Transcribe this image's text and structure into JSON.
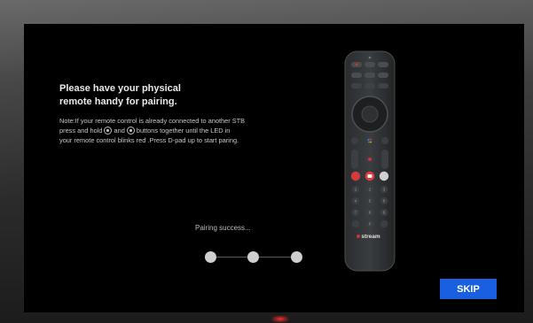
{
  "title": {
    "line1": "Please have your physical",
    "line2": "remote handy for pairing."
  },
  "note": {
    "line1": "Note:If your remote control is already connected to another STB",
    "line2_pre": "press and hold",
    "line2_mid": "and",
    "line2_post": "buttons together until the LED in",
    "line3": "your remote control blinks red .Press D-pad up to start paring."
  },
  "status": "Pairing success...",
  "progress": {
    "total_steps": 3,
    "current_step": 3
  },
  "skip_label": "SKIP",
  "remote": {
    "brand_label": "stream",
    "keypad": [
      "1",
      "2",
      "3",
      "4",
      "5",
      "6",
      "7",
      "8",
      "9",
      "0"
    ],
    "icons": [
      "power-icon",
      "voice-search-icon",
      "home-icon",
      "back-icon",
      "menu-icon",
      "netflix-icon",
      "youtube-icon",
      "app-icon"
    ]
  },
  "colors": {
    "accent": "#1a5fe0",
    "background": "#000000",
    "led_glow": "#ff2a2a"
  }
}
